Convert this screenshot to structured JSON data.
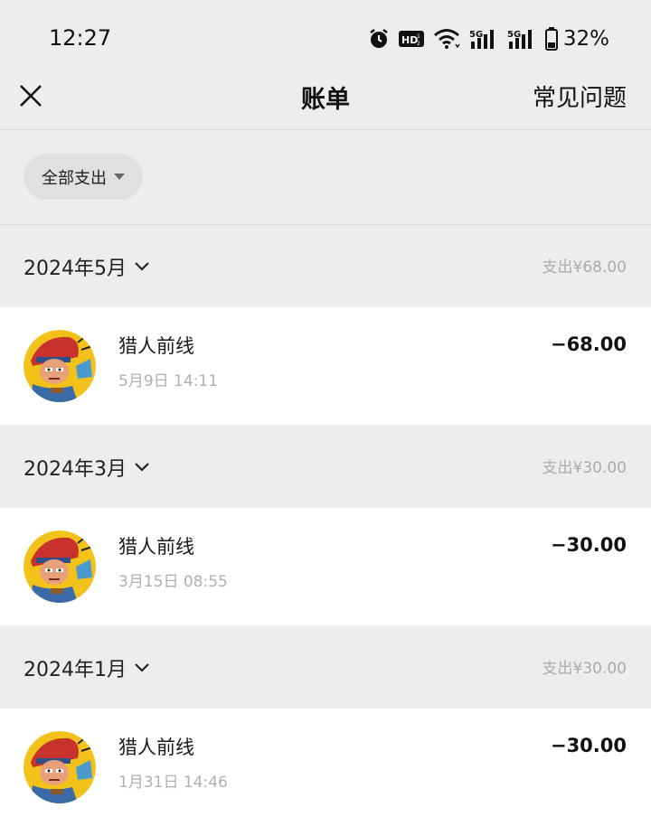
{
  "status_bar": {
    "time": "12:27",
    "battery": "32%",
    "icons": [
      "alarm-icon",
      "hd-icon",
      "wifi-icon",
      "signal-5g-icon",
      "signal-5g-icon",
      "battery-icon"
    ]
  },
  "nav": {
    "title": "账单",
    "faq": "常见问题",
    "close_icon": "close-icon"
  },
  "filter": {
    "label": "全部支出"
  },
  "months": [
    {
      "label": "2024年5月",
      "total": "支出¥68.00"
    },
    {
      "label": "2024年3月",
      "total": "支出¥30.00"
    },
    {
      "label": "2024年1月",
      "total": "支出¥30.00"
    }
  ],
  "records": [
    {
      "name": "猎人前线",
      "time": "5月9日 14:11",
      "amount": "−68.00"
    },
    {
      "name": "猎人前线",
      "time": "3月15日 08:55",
      "amount": "−30.00"
    },
    {
      "name": "猎人前线",
      "time": "1月31日 14:46",
      "amount": "−30.00"
    }
  ],
  "colors": {
    "background": "#ededed",
    "card": "#ffffff",
    "muted_text": "#ababab"
  }
}
